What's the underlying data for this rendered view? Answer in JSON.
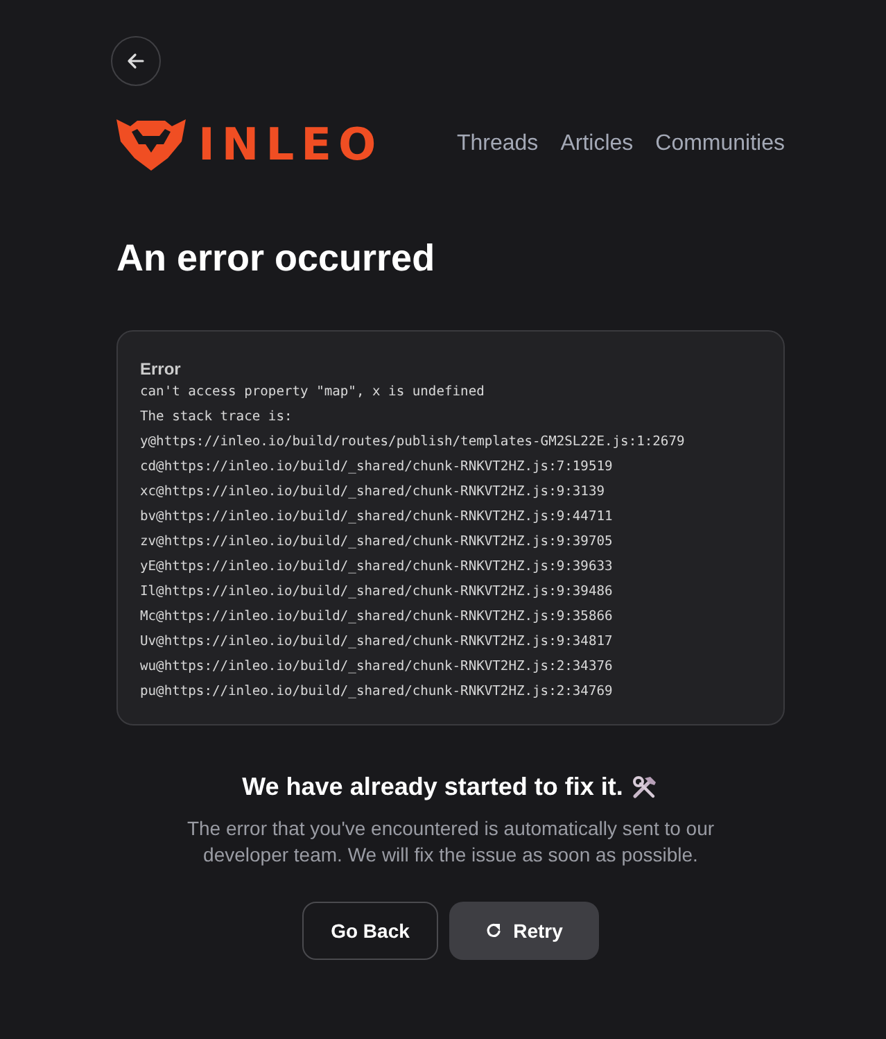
{
  "header": {
    "logo_text": "INLEO",
    "nav": [
      {
        "label": "Threads"
      },
      {
        "label": "Articles"
      },
      {
        "label": "Communities"
      }
    ]
  },
  "title": "An error occurred",
  "error_box": {
    "label": "Error",
    "lines": [
      "can't access property \"map\", x is undefined",
      "The stack trace is:",
      "y@https://inleo.io/build/routes/publish/templates-GM2SL22E.js:1:2679",
      "cd@https://inleo.io/build/_shared/chunk-RNKVT2HZ.js:7:19519",
      "xc@https://inleo.io/build/_shared/chunk-RNKVT2HZ.js:9:3139",
      "bv@https://inleo.io/build/_shared/chunk-RNKVT2HZ.js:9:44711",
      "zv@https://inleo.io/build/_shared/chunk-RNKVT2HZ.js:9:39705",
      "yE@https://inleo.io/build/_shared/chunk-RNKVT2HZ.js:9:39633",
      "Il@https://inleo.io/build/_shared/chunk-RNKVT2HZ.js:9:39486",
      "Mc@https://inleo.io/build/_shared/chunk-RNKVT2HZ.js:9:35866",
      "Uv@https://inleo.io/build/_shared/chunk-RNKVT2HZ.js:9:34817",
      "wu@https://inleo.io/build/_shared/chunk-RNKVT2HZ.js:2:34376",
      "pu@https://inleo.io/build/_shared/chunk-RNKVT2HZ.js:2:34769"
    ]
  },
  "message": {
    "heading": "We have already started to fix it.",
    "body": "The error that you've encountered is automatically sent to our developer team. We will fix the issue as soon as possible."
  },
  "buttons": [
    {
      "label": "Go Back",
      "kind": "outline"
    },
    {
      "label": "Retry",
      "kind": "retry"
    }
  ]
}
